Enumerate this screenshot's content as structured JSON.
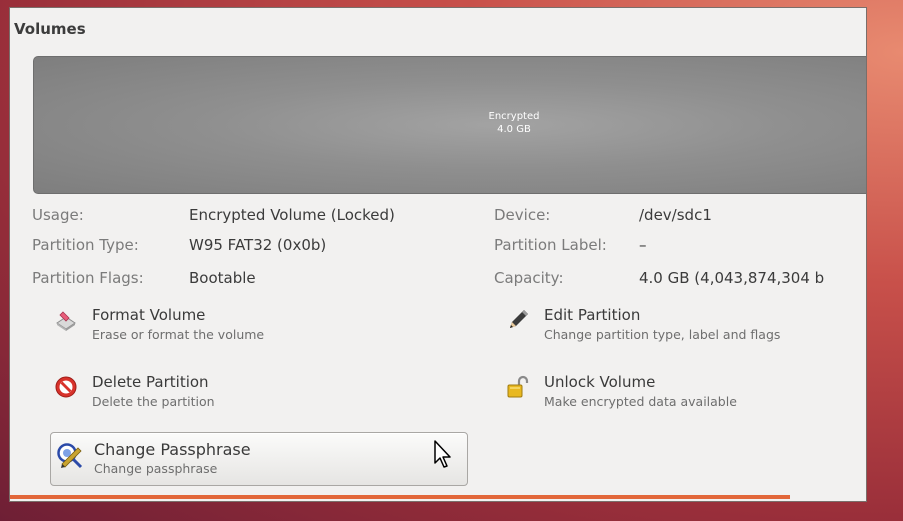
{
  "section": {
    "title": "Volumes"
  },
  "volume": {
    "name": "Encrypted",
    "size": "4.0 GB"
  },
  "info": {
    "usage_label": "Usage:",
    "usage_value": "Encrypted Volume (Locked)",
    "ptype_label": "Partition Type:",
    "ptype_value": "W95 FAT32 (0x0b)",
    "pflags_label": "Partition Flags:",
    "pflags_value": "Bootable",
    "device_label": "Device:",
    "device_value": "/dev/sdc1",
    "plabel_label": "Partition Label:",
    "plabel_value": "–",
    "capacity_label": "Capacity:",
    "capacity_value": "4.0 GB (4,043,874,304 b"
  },
  "actions": {
    "format": {
      "title": "Format Volume",
      "subtitle": "Erase or format the volume"
    },
    "edit": {
      "title": "Edit Partition",
      "subtitle": "Change partition type, label and flags"
    },
    "delete": {
      "title": "Delete Partition",
      "subtitle": "Delete the partition"
    },
    "unlock": {
      "title": "Unlock Volume",
      "subtitle": "Make encrypted data available"
    },
    "passphrase": {
      "title": "Change Passphrase",
      "subtitle": "Change passphrase"
    }
  },
  "colors": {
    "accent": "#e2673a",
    "bar": "#8f8f8f"
  }
}
